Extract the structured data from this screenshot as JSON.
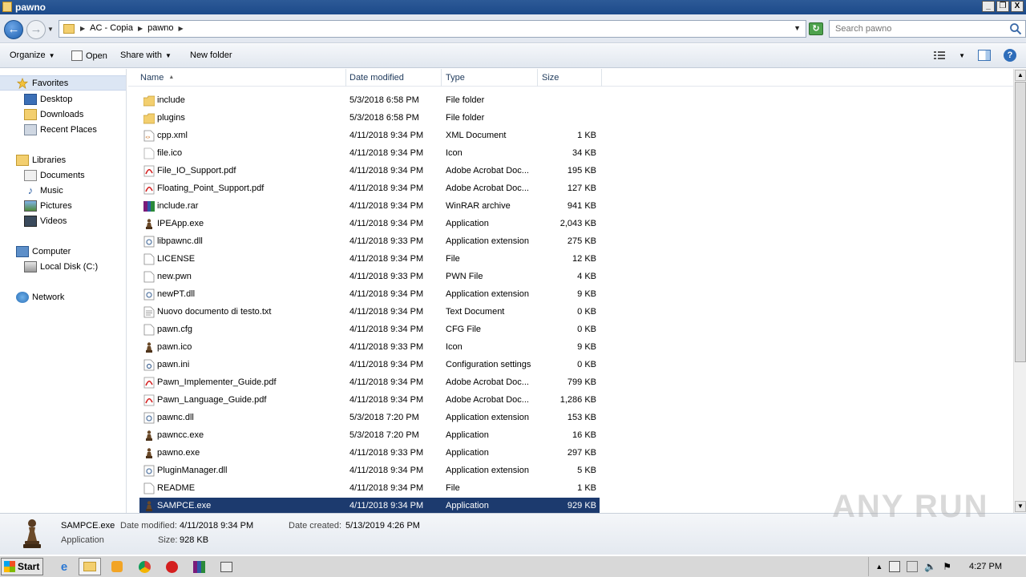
{
  "window": {
    "title": "pawno",
    "min": "_",
    "restore": "❐",
    "close": "X"
  },
  "address": {
    "crumbs": [
      "AC - Copia",
      "pawno"
    ],
    "search_placeholder": "Search pawno"
  },
  "toolbar": {
    "organize": "Organize",
    "open": "Open",
    "share_with": "Share with",
    "new_folder": "New folder"
  },
  "nav": {
    "favorites": "Favorites",
    "desktop": "Desktop",
    "downloads": "Downloads",
    "recent_places": "Recent Places",
    "libraries": "Libraries",
    "documents": "Documents",
    "music": "Music",
    "pictures": "Pictures",
    "videos": "Videos",
    "computer": "Computer",
    "local_disk": "Local Disk (C:)",
    "network": "Network"
  },
  "columns": {
    "name": "Name",
    "date": "Date modified",
    "type": "Type",
    "size": "Size"
  },
  "files": [
    {
      "name": "include",
      "date": "5/3/2018 6:58 PM",
      "type": "File folder",
      "size": "",
      "icon": "folder-icon"
    },
    {
      "name": "plugins",
      "date": "5/3/2018 6:58 PM",
      "type": "File folder",
      "size": "",
      "icon": "folder-icon"
    },
    {
      "name": "cpp.xml",
      "date": "4/11/2018 9:34 PM",
      "type": "XML Document",
      "size": "1 KB",
      "icon": "xml-file-icon"
    },
    {
      "name": "file.ico",
      "date": "4/11/2018 9:34 PM",
      "type": "Icon",
      "size": "34 KB",
      "icon": "ico-file-icon"
    },
    {
      "name": "File_IO_Support.pdf",
      "date": "4/11/2018 9:34 PM",
      "type": "Adobe Acrobat Doc...",
      "size": "195 KB",
      "icon": "pdf-icon"
    },
    {
      "name": "Floating_Point_Support.pdf",
      "date": "4/11/2018 9:34 PM",
      "type": "Adobe Acrobat Doc...",
      "size": "127 KB",
      "icon": "pdf-icon"
    },
    {
      "name": "include.rar",
      "date": "4/11/2018 9:34 PM",
      "type": "WinRAR archive",
      "size": "941 KB",
      "icon": "rar-icon"
    },
    {
      "name": "IPEApp.exe",
      "date": "4/11/2018 9:34 PM",
      "type": "Application",
      "size": "2,043 KB",
      "icon": "pawn-exe-icon"
    },
    {
      "name": "libpawnc.dll",
      "date": "4/11/2018 9:33 PM",
      "type": "Application extension",
      "size": "275 KB",
      "icon": "dll-icon"
    },
    {
      "name": "LICENSE",
      "date": "4/11/2018 9:34 PM",
      "type": "File",
      "size": "12 KB",
      "icon": "blank-file-icon"
    },
    {
      "name": "new.pwn",
      "date": "4/11/2018 9:33 PM",
      "type": "PWN File",
      "size": "4 KB",
      "icon": "blank-file-icon"
    },
    {
      "name": "newPT.dll",
      "date": "4/11/2018 9:34 PM",
      "type": "Application extension",
      "size": "9 KB",
      "icon": "dll-icon"
    },
    {
      "name": "Nuovo documento di testo.txt",
      "date": "4/11/2018 9:34 PM",
      "type": "Text Document",
      "size": "0 KB",
      "icon": "text-file-icon"
    },
    {
      "name": "pawn.cfg",
      "date": "4/11/2018 9:34 PM",
      "type": "CFG File",
      "size": "0 KB",
      "icon": "blank-file-icon"
    },
    {
      "name": "pawn.ico",
      "date": "4/11/2018 9:33 PM",
      "type": "Icon",
      "size": "9 KB",
      "icon": "pawn-exe-icon"
    },
    {
      "name": "pawn.ini",
      "date": "4/11/2018 9:34 PM",
      "type": "Configuration settings",
      "size": "0 KB",
      "icon": "ini-file-icon"
    },
    {
      "name": "Pawn_Implementer_Guide.pdf",
      "date": "4/11/2018 9:34 PM",
      "type": "Adobe Acrobat Doc...",
      "size": "799 KB",
      "icon": "pdf-icon"
    },
    {
      "name": "Pawn_Language_Guide.pdf",
      "date": "4/11/2018 9:34 PM",
      "type": "Adobe Acrobat Doc...",
      "size": "1,286 KB",
      "icon": "pdf-icon"
    },
    {
      "name": "pawnc.dll",
      "date": "5/3/2018 7:20 PM",
      "type": "Application extension",
      "size": "153 KB",
      "icon": "dll-icon"
    },
    {
      "name": "pawncc.exe",
      "date": "5/3/2018 7:20 PM",
      "type": "Application",
      "size": "16 KB",
      "icon": "pawn-exe-icon"
    },
    {
      "name": "pawno.exe",
      "date": "4/11/2018 9:33 PM",
      "type": "Application",
      "size": "297 KB",
      "icon": "pawn-exe-icon"
    },
    {
      "name": "PluginManager.dll",
      "date": "4/11/2018 9:34 PM",
      "type": "Application extension",
      "size": "5 KB",
      "icon": "dll-icon"
    },
    {
      "name": "README",
      "date": "4/11/2018 9:34 PM",
      "type": "File",
      "size": "1 KB",
      "icon": "blank-file-icon"
    },
    {
      "name": "SAMPCE.exe",
      "date": "4/11/2018 9:34 PM",
      "type": "Application",
      "size": "929 KB",
      "icon": "pawn-exe-icon",
      "selected": true
    }
  ],
  "details": {
    "name": "SAMPCE.exe",
    "type": "Application",
    "date_modified_label": "Date modified:",
    "date_modified": "4/11/2018 9:34 PM",
    "size_label": "Size:",
    "size": "928 KB",
    "date_created_label": "Date created:",
    "date_created": "5/13/2019 4:26 PM"
  },
  "watermark": "ANY RUN",
  "taskbar": {
    "start": "Start",
    "clock": "4:27 PM"
  },
  "colors": {
    "selected_row": "#1c3a6e",
    "title_bar": "#1c4a8a"
  }
}
